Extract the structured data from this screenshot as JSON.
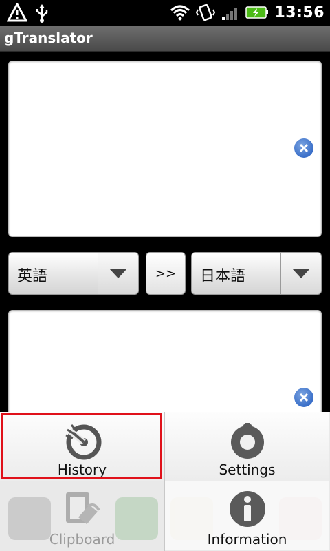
{
  "status_bar": {
    "time": "13:56",
    "icons": [
      "alert-icon",
      "usb-icon",
      "wifi-icon",
      "vibrate-icon",
      "signal-icon",
      "battery-charging-icon"
    ]
  },
  "app": {
    "title": "gTranslator"
  },
  "source_text": {
    "value": ""
  },
  "target_text": {
    "value": ""
  },
  "languages": {
    "source": "英語",
    "target": "日本語",
    "swap_label": ">>"
  },
  "menu": {
    "items": [
      {
        "label": "History",
        "icon": "history-icon",
        "highlighted": true
      },
      {
        "label": "Settings",
        "icon": "settings-icon"
      },
      {
        "label": "Clipboard",
        "icon": "clipboard-icon",
        "disabled": true
      },
      {
        "label": "Information",
        "icon": "info-icon"
      }
    ]
  },
  "colors": {
    "highlight": "#e0111a",
    "clear_button": "#3a6fc9",
    "title_bar": "#5a5a5a"
  }
}
